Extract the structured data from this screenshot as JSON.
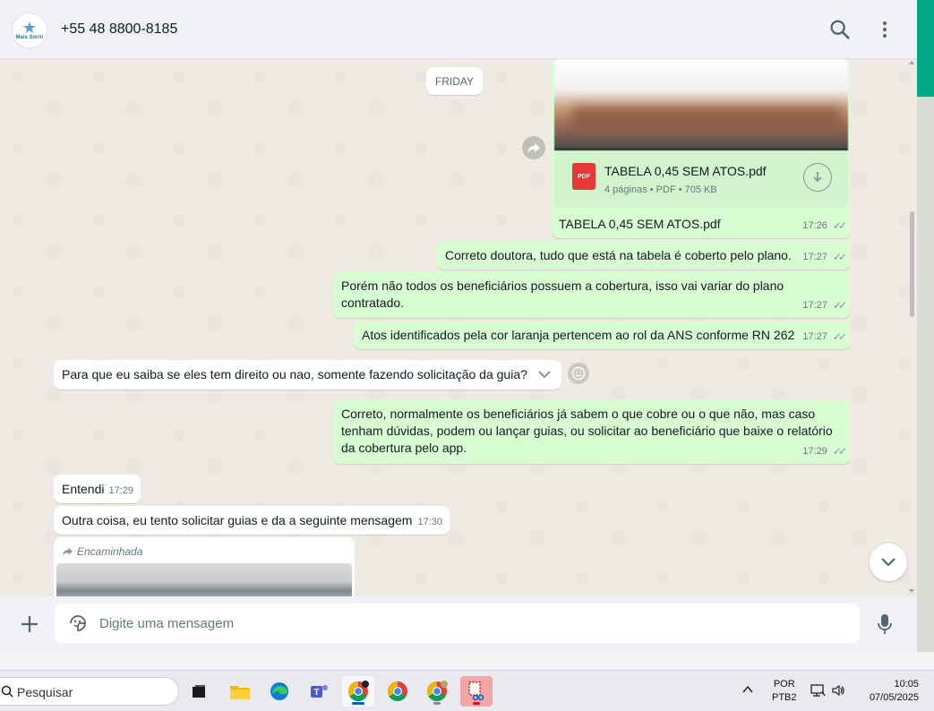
{
  "header": {
    "avatar_brand": "Mais Sorrir",
    "contact_name": "+55 48 8800-8185"
  },
  "chat": {
    "date_chip": "FRIDAY",
    "pdf_message": {
      "file_name": "TABELA 0,45 SEM ATOS.pdf",
      "file_info": "4 páginas • PDF • 705 KB",
      "icon_label": "PDF",
      "caption": "TABELA 0,45 SEM ATOS.pdf",
      "time": "17:26"
    },
    "messages": [
      {
        "text": "Correto doutora, tudo que está na tabela é coberto pelo plano.",
        "time": "17:27",
        "dir": "out"
      },
      {
        "text": "Porém não todos os beneficiários possuem a cobertura, isso vai variar do plano contratado.",
        "time": "17:27",
        "dir": "out"
      },
      {
        "text": "Atos identificados pela cor laranja pertencem ao rol da ANS conforme RN 262",
        "time": "17:27",
        "dir": "out"
      },
      {
        "text": "Para que eu saiba se eles tem direito ou nao, somente fazendo solicitação da guia?",
        "time": "",
        "dir": "in"
      },
      {
        "text": "Correto, normalmente os beneficiários já sabem o que cobre ou o que não, mas caso tenham dúvidas, podem ou lançar guias, ou solicitar ao beneficiário que baixe o relatório da cobertura pelo app.",
        "time": "17:29",
        "dir": "out"
      },
      {
        "text": "Entendi",
        "time": "17:29",
        "dir": "in"
      },
      {
        "text": "Outra coisa, eu tento solicitar guias e da a seguinte mensagem",
        "time": "17:30",
        "dir": "in"
      }
    ],
    "forwarded_label": "Encaminhada"
  },
  "footer": {
    "placeholder": "Digite uma mensagem"
  },
  "taskbar": {
    "search_text": "Pesquisar",
    "lang_line1": "POR",
    "lang_line2": "PTB2",
    "time": "10:05",
    "date": "07/05/2025"
  },
  "colors": {
    "outgoing_bubble": "#d9fdd3",
    "incoming_bubble": "#ffffff",
    "chat_background": "#efeae2",
    "accent": "#00a884"
  }
}
